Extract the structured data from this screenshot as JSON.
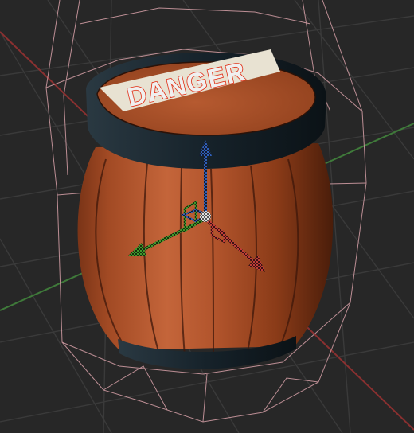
{
  "viewport": {
    "background": "#272727",
    "grid_color": "#3a3a3a",
    "axis_x_color": "#8a3030",
    "axis_y_color": "#3f7a3a"
  },
  "barrel": {
    "label": "DANGER",
    "label_color": "#e02a10",
    "label_plate_color": "#e8e2d2",
    "wood_color": "#b5572f",
    "wood_dark_color": "#6e2d12",
    "band_color": "#17232c"
  },
  "gizmo": {
    "x_color": "#c23b38",
    "y_color": "#3d9a2c",
    "z_color": "#2f5fb8",
    "center_color": "#d8d8d8"
  },
  "selection": {
    "wire_color": "#d7a0a8"
  }
}
